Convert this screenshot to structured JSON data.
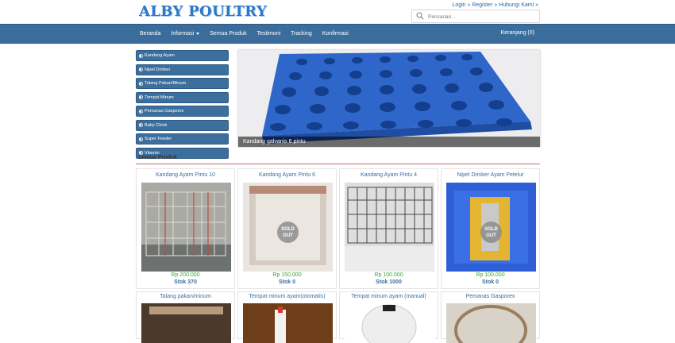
{
  "header": {
    "logo_text": "ALBY POULTRY",
    "toplinks": "Login » Register » Hubungi Kami »",
    "search_placeholder": "Pencarian..."
  },
  "nav": {
    "items": [
      "Beranda",
      "Informasi",
      "Semua Produk",
      "Testimoni",
      "Tracking",
      "Konfirmasi"
    ],
    "cart": "Keranjang (0)"
  },
  "sidebar": {
    "items": [
      "Kandang Ayam",
      "Nipel Drinker",
      "Talang Pakan/Minum",
      "Tempat Minum",
      "Pemanas Gasporex",
      "Baby Chick",
      "Super Feeder",
      "Vitamin"
    ]
  },
  "banner": {
    "caption": "Kandang galvanis 6 pintu"
  },
  "section": {
    "title": "Semua Produk"
  },
  "products": [
    {
      "name": "Kandang Ayam Pintu 10",
      "price": "Rp 200.000",
      "stock": "Stok 370"
    },
    {
      "name": "Kandang Ayam Pintu 6",
      "price": "Rp 150.000",
      "stock": "Stok 0",
      "sold": "SOLD OUT"
    },
    {
      "name": "Kandang Ayam Pintu 4",
      "price": "Rp 100.000",
      "stock": "Stok 1000"
    },
    {
      "name": "Nipel Drinker Ayam Petelur",
      "price": "Rp 100.000",
      "stock": "Stok 0",
      "sold": "SOLD OUT"
    }
  ],
  "products_row2": [
    {
      "name": "Talang pakan/minum"
    },
    {
      "name": "Tempat minum ayam(otomatis)"
    },
    {
      "name": "Tempat minum ayam (manual)"
    },
    {
      "name": "Pemanas Gasporex"
    }
  ],
  "sold_labels": {
    "top": "SOLD",
    "bottom": "OUT"
  }
}
